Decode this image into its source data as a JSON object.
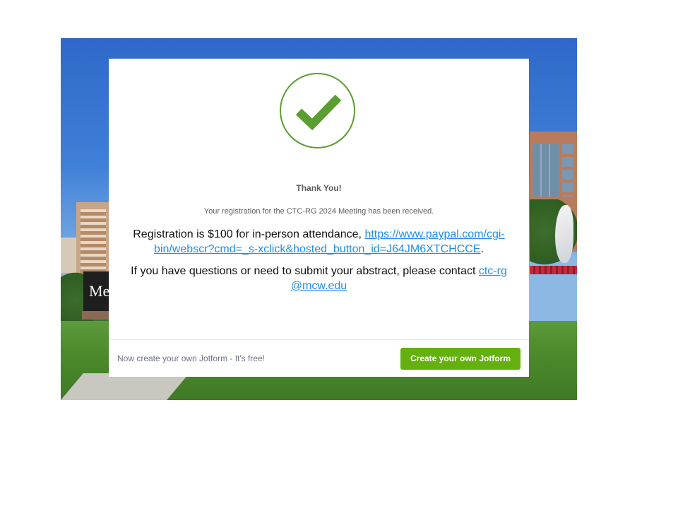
{
  "background": {
    "sign_text": "Med"
  },
  "card": {
    "title": "Thank You!",
    "received": "Your registration for the CTC-RG 2024 Meeting has been received.",
    "registration_text": "Registration is $100 for in-person attendance, ",
    "registration_link": "https://www.paypal.com/cgi-bin/webscr?cmd=_s-xclick&hosted_button_id=J64JM6XTCHCCE",
    "registration_end": ".",
    "contact_text": "If you have questions or need to submit your abstract, please contact ",
    "contact_link": "ctc-rg@mcw.edu"
  },
  "footer": {
    "text": "Now create your own Jotform - It's free!",
    "button_label": "Create your own Jotform"
  },
  "colors": {
    "success_green": "#5a9e2f",
    "button_green": "#64b00f",
    "link_blue": "#1e8fe6"
  },
  "icons": {
    "success": "checkmark-icon"
  }
}
